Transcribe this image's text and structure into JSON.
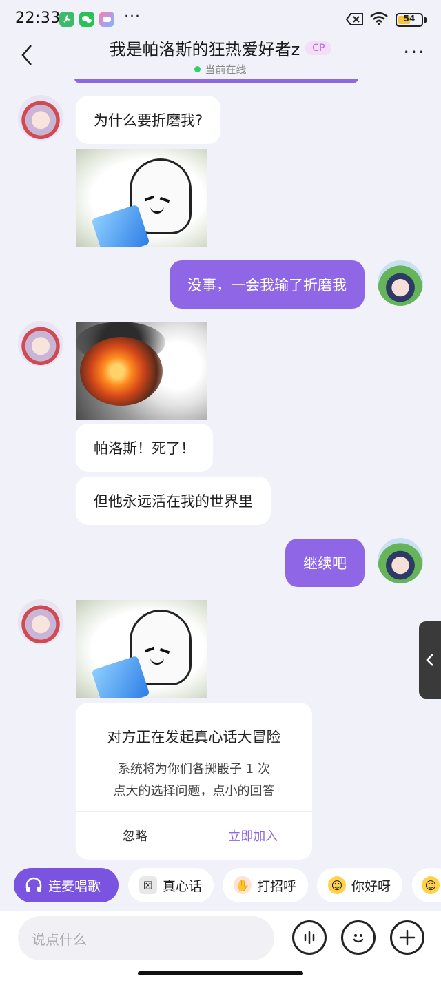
{
  "status_bar": {
    "time": "22:33",
    "dots": "···",
    "battery": "54",
    "icons": [
      "tool-icon",
      "wechat-icon",
      "game-icon",
      "close-box-icon",
      "wifi-icon"
    ]
  },
  "header": {
    "title": "我是帕洛斯的狂热爱好者z",
    "badge": "CP",
    "status": "当前在线",
    "more": "···"
  },
  "messages": [
    {
      "side": "in",
      "type": "text",
      "text": "为什么要折磨我?"
    },
    {
      "side": "in",
      "type": "sticker",
      "sticker": "phone-meme-face"
    },
    {
      "side": "out",
      "type": "text",
      "text": "没事，一会我输了折磨我"
    },
    {
      "side": "in",
      "type": "sticker",
      "sticker": "explosion"
    },
    {
      "side": "in",
      "type": "text",
      "text": "帕洛斯！死了！"
    },
    {
      "side": "in",
      "type": "text",
      "text": "但他永远活在我的世界里"
    },
    {
      "side": "out",
      "type": "text",
      "text": "继续吧"
    },
    {
      "side": "in",
      "type": "sticker",
      "sticker": "phone-meme-face"
    }
  ],
  "game_card": {
    "title": "对方正在发起真心话大冒险",
    "line1": "系统将为你们各掷骰子 1 次",
    "line2": "点大的选择问题，点小的回答",
    "ignore": "忽略",
    "join": "立即加入"
  },
  "chips": [
    {
      "label": "连麦唱歌",
      "icon": "headphones-icon"
    },
    {
      "label": "真心话",
      "icon": "dice-icon"
    },
    {
      "label": "打招呼",
      "icon": "wave-icon"
    },
    {
      "label": "你好呀",
      "icon": "laughing-face-icon"
    }
  ],
  "input": {
    "placeholder": "说点什么"
  },
  "colors": {
    "accent": "#8f66e6",
    "background": "#f1f1f9",
    "online": "#2fd26a",
    "badge_text": "#b06ad9"
  }
}
